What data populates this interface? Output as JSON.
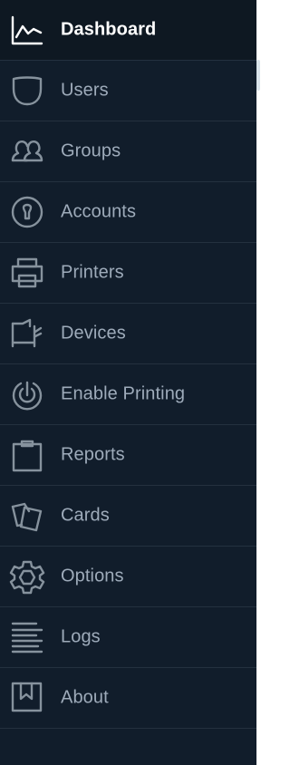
{
  "sidebar": {
    "items": [
      {
        "label": "Dashboard",
        "icon": "chart-line-icon",
        "active": true
      },
      {
        "label": "Users",
        "icon": "user-icon"
      },
      {
        "label": "Groups",
        "icon": "group-icon"
      },
      {
        "label": "Accounts",
        "icon": "keyhole-icon"
      },
      {
        "label": "Printers",
        "icon": "printer-icon"
      },
      {
        "label": "Devices",
        "icon": "device-icon"
      },
      {
        "label": "Enable Printing",
        "icon": "target-icon"
      },
      {
        "label": "Reports",
        "icon": "clipboard-icon"
      },
      {
        "label": "Cards",
        "icon": "cards-icon"
      },
      {
        "label": "Options",
        "icon": "gear-icon"
      },
      {
        "label": "Logs",
        "icon": "lines-icon"
      },
      {
        "label": "About",
        "icon": "bookmark-icon"
      }
    ]
  },
  "colors": {
    "sidebar_bg": "#111d2b",
    "active_bg": "#0e1822",
    "label": "#9eabba",
    "active_label": "#ffffff",
    "icon": "#86929d",
    "divider": "#24313f"
  }
}
